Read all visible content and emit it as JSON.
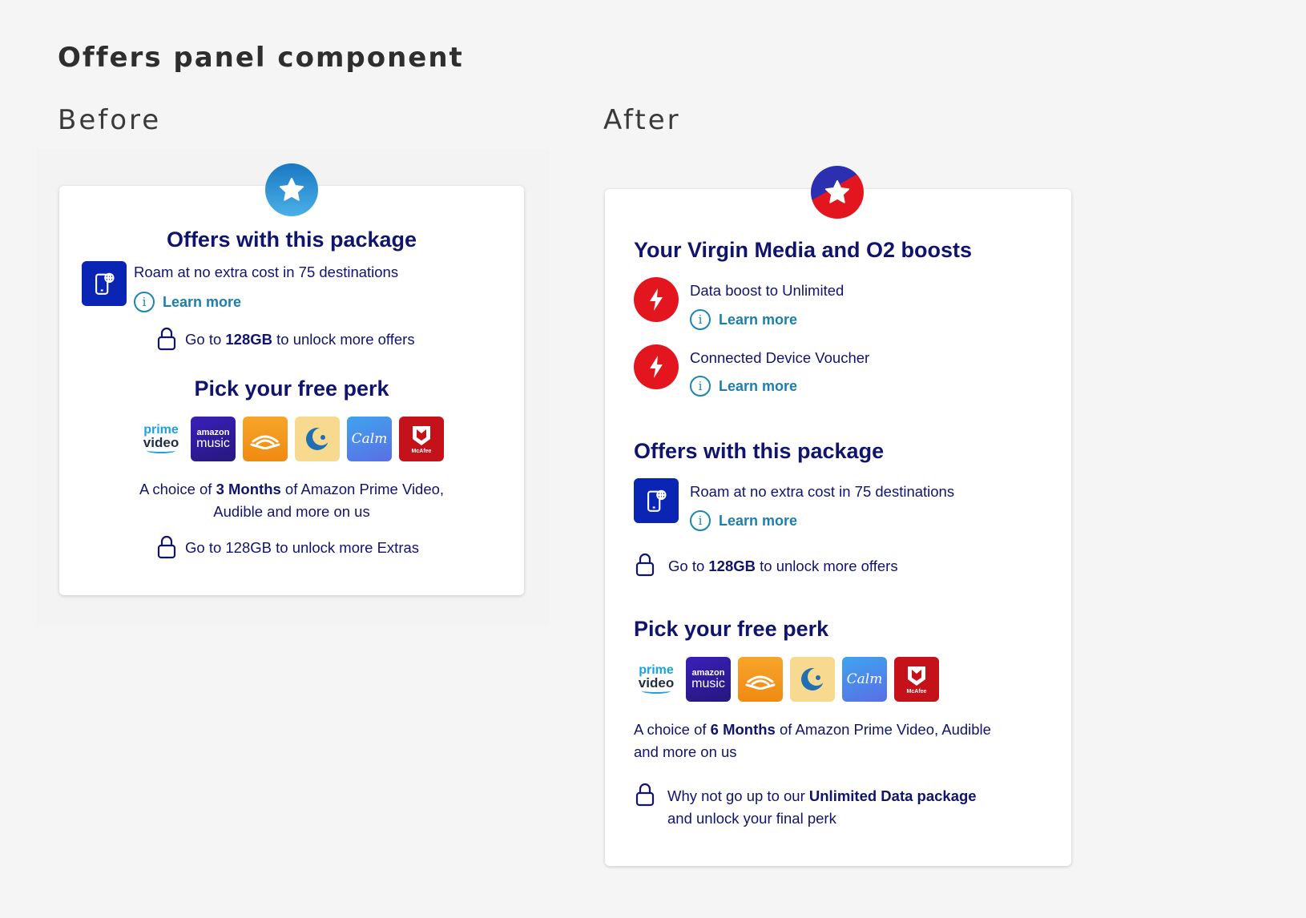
{
  "page_title": "Offers panel component",
  "before": {
    "label": "Before",
    "offers_heading": "Offers with this package",
    "roam_text": "Roam at no extra cost in 75 destinations",
    "learn_more": "Learn more",
    "unlock_offers": {
      "pre": "Go to ",
      "bold": "128GB",
      "post": " to unlock more offers"
    },
    "perk_heading": "Pick your free perk",
    "perk_desc_line1": {
      "pre": "A choice of ",
      "bold": "3 Months",
      "post": " of Amazon Prime Video,"
    },
    "perk_desc_line2": "Audible and more on us",
    "unlock_extras": "Go to 128GB to unlock more Extras"
  },
  "after": {
    "label": "After",
    "boosts_heading": "Your Virgin Media and O2 boosts",
    "boost1": "Data boost to Unlimited",
    "boost2": "Connected Device Voucher",
    "learn_more": "Learn more",
    "offers_heading": "Offers with this package",
    "roam_text": "Roam at no extra cost in 75 destinations",
    "unlock_offers": {
      "pre": "Go to ",
      "bold": "128GB",
      "post": " to unlock more offers"
    },
    "perk_heading": "Pick your free perk",
    "perk_desc_line1": {
      "pre": "A choice of ",
      "bold": "6 Months",
      "post": " of Amazon Prime Video, Audible"
    },
    "perk_desc_line2": "and more on us",
    "upgrade_line1": {
      "pre": "Why not go up to our ",
      "bold": "Unlimited Data package"
    },
    "upgrade_line2": "and unlock your final perk"
  },
  "perks": {
    "prime_t1": "prime",
    "prime_t2": "video",
    "music_t1": "amazon",
    "music_t2": "music",
    "calm": "Calm",
    "mcafee": "McAfee",
    "icons": [
      "prime-video-icon",
      "amazon-music-icon",
      "audible-icon",
      "calm-sleep-icon",
      "calm-icon",
      "mcafee-icon"
    ]
  },
  "colors": {
    "navy": "#11146d",
    "link": "#1b7fae",
    "blue_square": "#0a24b4",
    "red": "#e3161f"
  }
}
